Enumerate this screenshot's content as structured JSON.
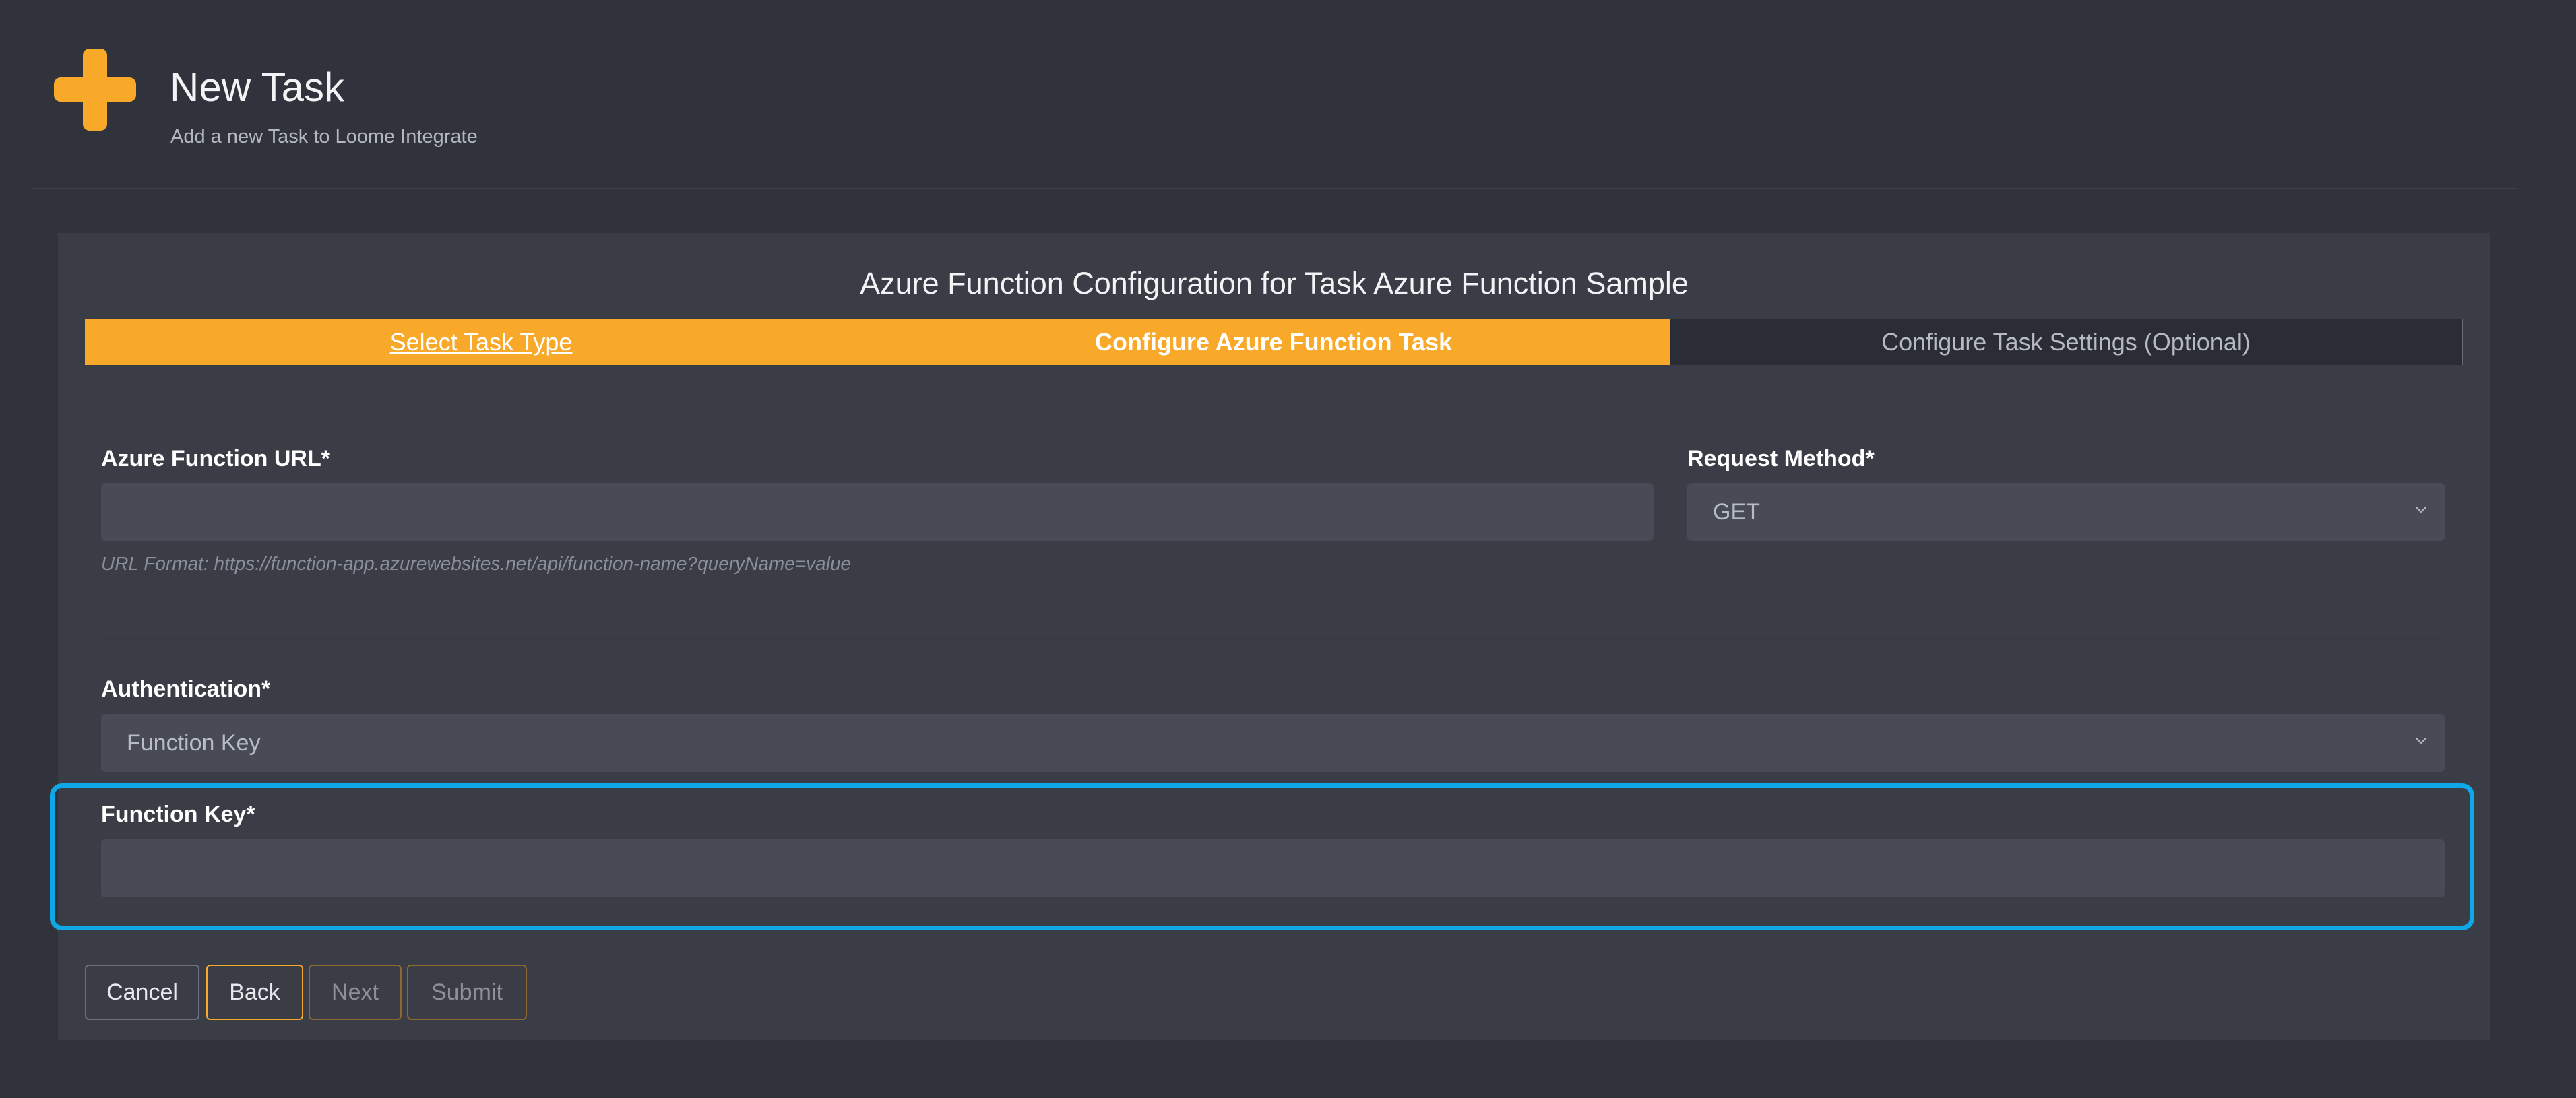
{
  "header": {
    "icon": "plus-icon",
    "title": "New Task",
    "subtitle": "Add a new Task to Loome Integrate"
  },
  "wizard": {
    "title": "Azure Function Configuration for Task Azure Function Sample",
    "steps": [
      {
        "label": "Select Task Type",
        "state": "completed"
      },
      {
        "label": "Configure Azure Function Task",
        "state": "active"
      },
      {
        "label": "Configure Task Settings (Optional)",
        "state": "pending"
      }
    ]
  },
  "form": {
    "url": {
      "label": "Azure Function URL*",
      "value": "",
      "helper": "URL Format: https://function-app.azurewebsites.net/api/function-name?queryName=value"
    },
    "request_method": {
      "label": "Request Method*",
      "selected": "GET"
    },
    "authentication": {
      "label": "Authentication*",
      "selected": "Function Key"
    },
    "function_key": {
      "label": "Function Key*",
      "value": ""
    }
  },
  "buttons": {
    "cancel": "Cancel",
    "back": "Back",
    "next": "Next",
    "submit": "Submit"
  },
  "colors": {
    "accent": "#f8a929",
    "highlight": "#0ea7e8",
    "background": "#31333c",
    "card": "#3a3c46"
  }
}
